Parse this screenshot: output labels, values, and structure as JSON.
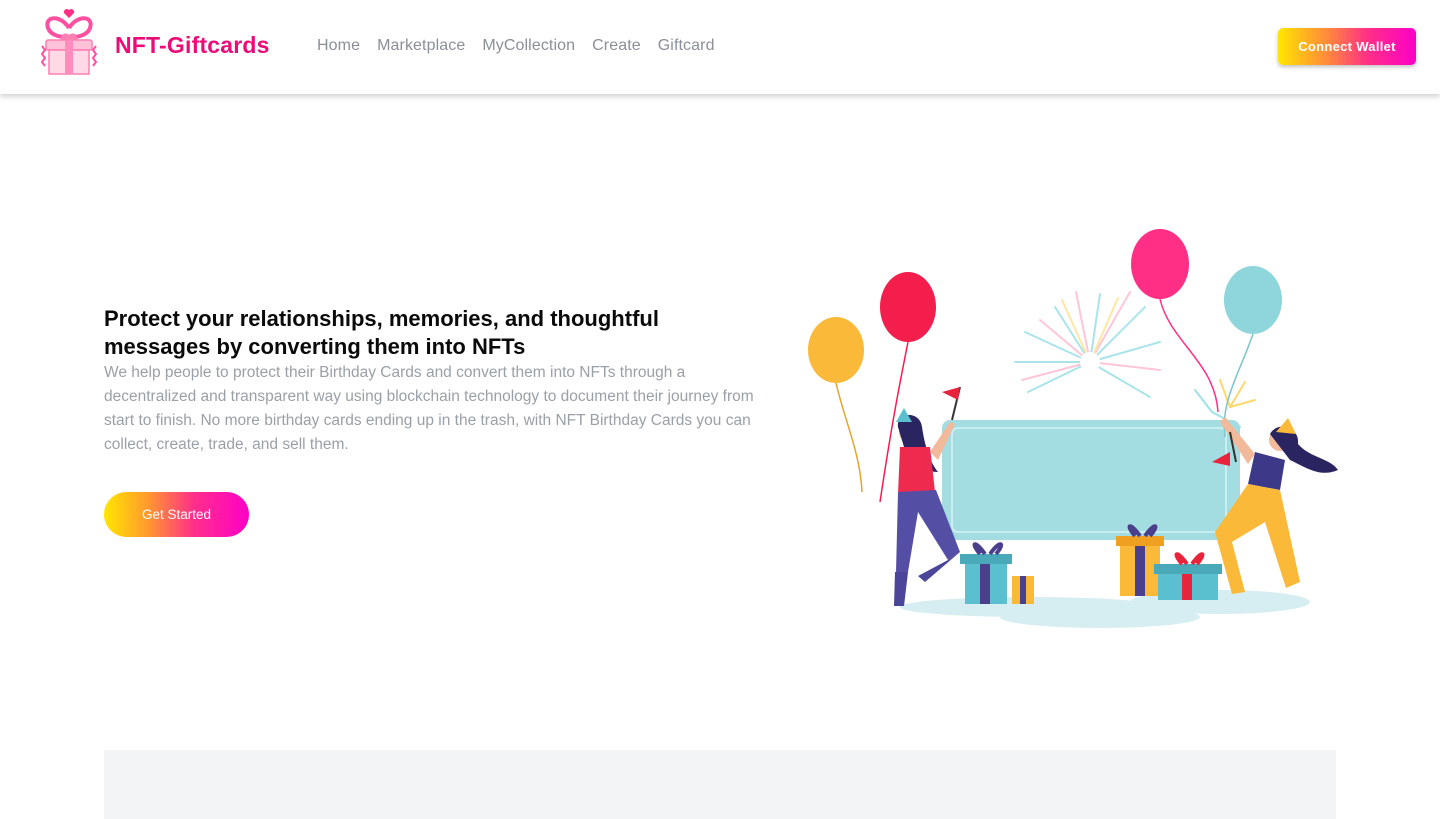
{
  "header": {
    "brand": "NFT-Giftcards",
    "logo_icon": "gift-hearts-logo",
    "nav": [
      {
        "label": "Home"
      },
      {
        "label": "Marketplace"
      },
      {
        "label": "MyCollection"
      },
      {
        "label": "Create"
      },
      {
        "label": "Giftcard"
      }
    ],
    "connect_label": "Connect Wallet"
  },
  "hero": {
    "title": "Protect your relationships, memories, and thoughtful messages by converting them into NFTs",
    "description": "We help people to protect their Birthday Cards and convert them into NFTs through a decentralized and transparent way using blockchain technology to document their journey from start to finish. No more birthday cards ending up in the trash, with NFT Birthday Cards you can collect, create, trade, and sell them.",
    "cta_label": "Get Started",
    "illustration": "birthday-party-illustration"
  },
  "colors": {
    "brand_pink": "#ec0c78",
    "nav_text": "#8a8f98",
    "gradient_start": "#ffe600",
    "gradient_end": "#ff00c8",
    "panel_bg": "#f3f4f6"
  }
}
